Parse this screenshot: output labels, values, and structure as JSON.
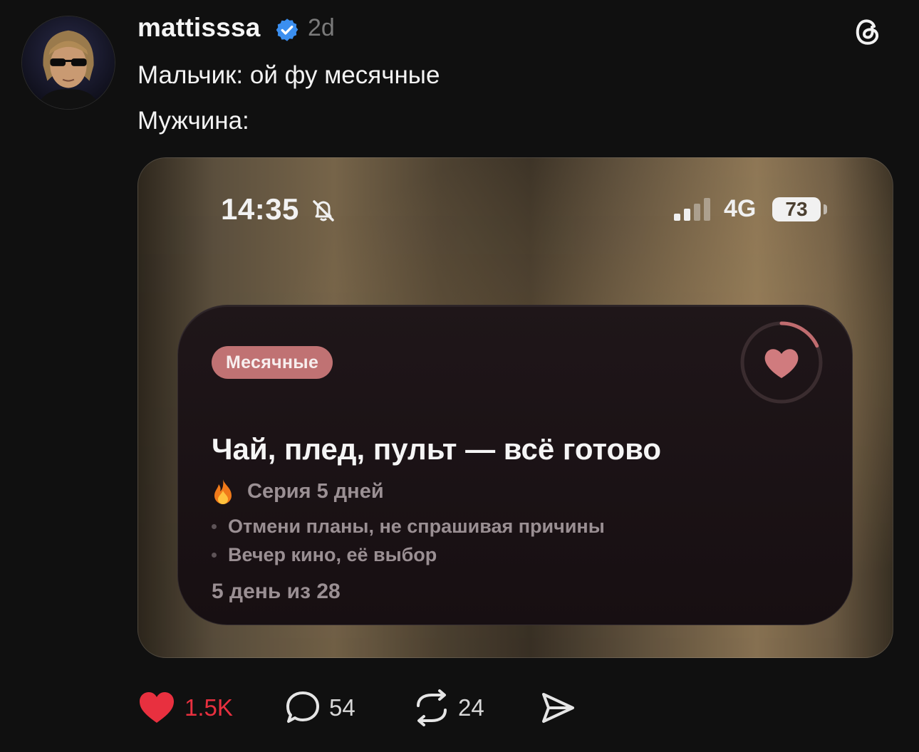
{
  "post": {
    "username": "mattisssa",
    "time_ago": "2d",
    "text_lines": [
      "Мальчик: ой фу месячные",
      "Мужчина:"
    ]
  },
  "screenshot": {
    "status_time": "14:35",
    "network": "4G",
    "battery": "73",
    "widget": {
      "tag": "Месячные",
      "title": "Чай, плед, пульт — всё готово",
      "streak": "Серия 5 дней",
      "bullets": [
        "Отмени планы, не спрашивая причины",
        "Вечер кино, её выбор"
      ],
      "day_counter": "5 день из 28",
      "ring_progress": 0.18
    }
  },
  "actions": {
    "likes": "1.5K",
    "comments": "54",
    "reposts": "24"
  },
  "colors": {
    "background": "#101010",
    "like_active": "#e8303f",
    "verified": "#3b8ff0",
    "tag_bg": "#c07273",
    "heart": "#d07b7e"
  },
  "icons": [
    "verified-badge-icon",
    "threads-logo-icon",
    "bell-muted-icon",
    "signal-icon",
    "heart-icon",
    "fire-icon",
    "like-icon",
    "comment-icon",
    "repost-icon",
    "share-icon"
  ]
}
